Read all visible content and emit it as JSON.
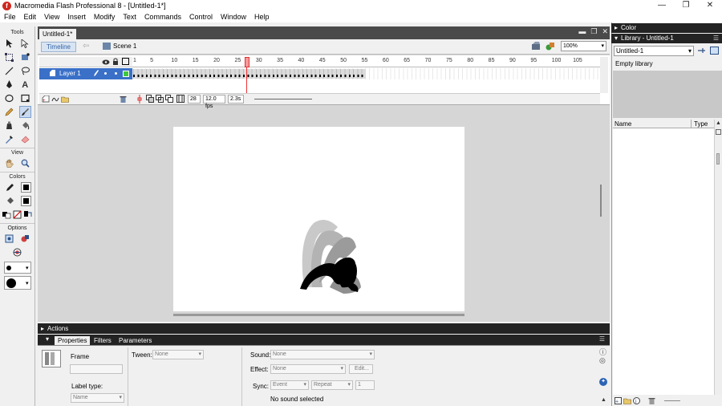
{
  "window": {
    "title": "Macromedia Flash Professional 8 - [Untitled-1*]",
    "minimize": "—",
    "maximize": "❐",
    "close": "✕"
  },
  "menu": [
    "File",
    "Edit",
    "View",
    "Insert",
    "Modify",
    "Text",
    "Commands",
    "Control",
    "Window",
    "Help"
  ],
  "tools": {
    "title": "Tools",
    "view_label": "View",
    "colors_label": "Colors",
    "options_label": "Options"
  },
  "document": {
    "tab": "Untitled-1*",
    "timeline_button": "Timeline",
    "scene": "Scene 1",
    "zoom": "100%"
  },
  "timeline": {
    "layer_name": "Layer 1",
    "ruler_numbers": [
      "1",
      "5",
      "10",
      "15",
      "20",
      "25",
      "30",
      "35",
      "40",
      "45",
      "50",
      "55",
      "60",
      "65",
      "70",
      "75",
      "80",
      "85",
      "90",
      "95",
      "100",
      "105"
    ],
    "current_frame": "28",
    "fps": "12.0 fps",
    "elapsed": "2.3s",
    "playhead_frame": 28,
    "last_keyframe": 55
  },
  "actions_panel": {
    "label": "Actions"
  },
  "properties": {
    "tabs": [
      "Properties",
      "Filters",
      "Parameters"
    ],
    "frame_label": "Frame",
    "tween_label": "Tween:",
    "tween_value": "None",
    "label_type_label": "Label type:",
    "label_type_value": "Name",
    "sound_label": "Sound:",
    "sound_value": "None",
    "effect_label": "Effect:",
    "effect_value": "None",
    "edit_button": "Edit...",
    "sync_label": "Sync:",
    "sync_value": "Event",
    "repeat_value": "Repeat",
    "repeat_count": "1",
    "no_sound": "No sound selected"
  },
  "color_panel": {
    "label": "Color"
  },
  "library": {
    "label": "Library - Untitled-1",
    "dropdown": "Untitled-1",
    "empty_text": "Empty library",
    "col_name": "Name",
    "col_type": "Type"
  },
  "colors": {
    "layer_highlight": "#3a70c8",
    "panel_header": "#232323",
    "playhead": "#e33333"
  }
}
